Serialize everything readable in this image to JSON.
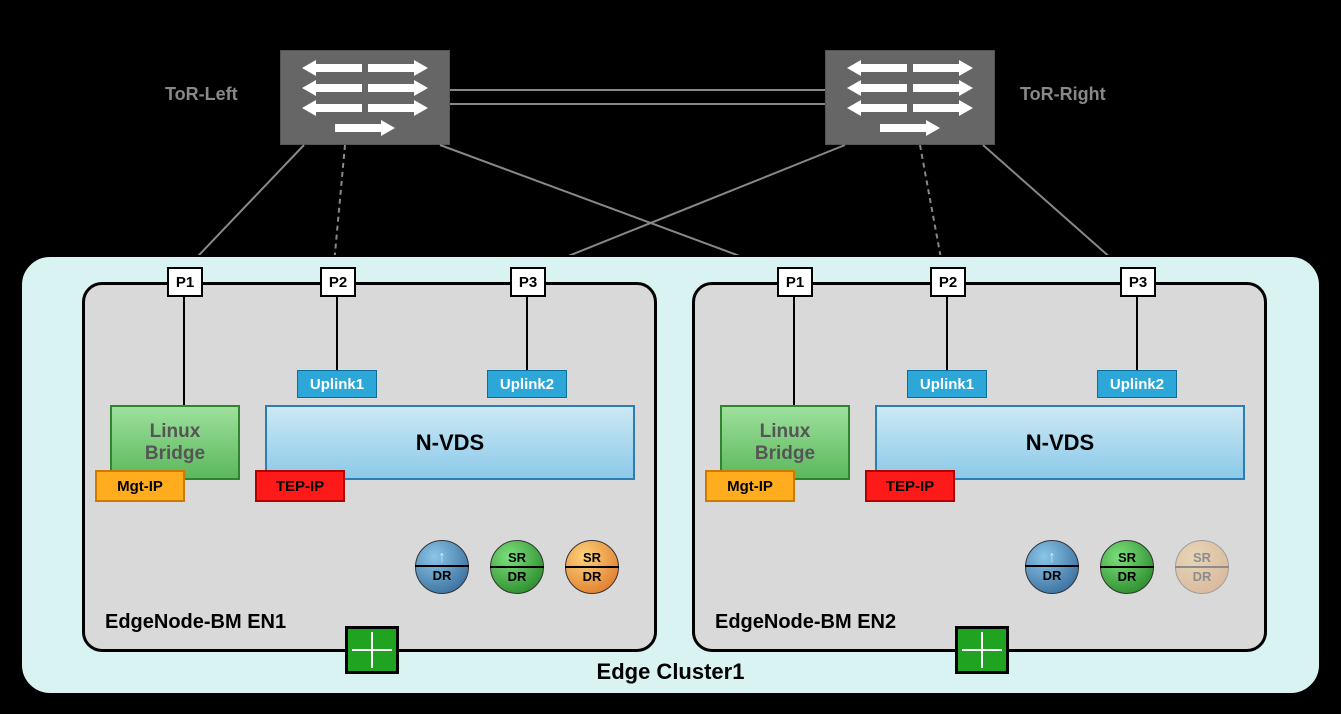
{
  "tor": {
    "left": "ToR-Left",
    "right": "ToR-Right"
  },
  "cluster": {
    "label": "Edge Cluster1"
  },
  "ports": {
    "p1": "P1",
    "p2": "P2",
    "p3": "P3"
  },
  "uplinks": {
    "u1": "Uplink1",
    "u2": "Uplink2"
  },
  "linux_bridge": {
    "line1": "Linux",
    "line2": "Bridge"
  },
  "nvds": "N-VDS",
  "mgt_ip": "Mgt-IP",
  "tep_ip": "TEP-IP",
  "router": {
    "sr": "SR",
    "dr": "DR"
  },
  "nodes": {
    "en1": {
      "label": "EdgeNode-BM EN1"
    },
    "en2": {
      "label": "EdgeNode-BM EN2"
    }
  }
}
